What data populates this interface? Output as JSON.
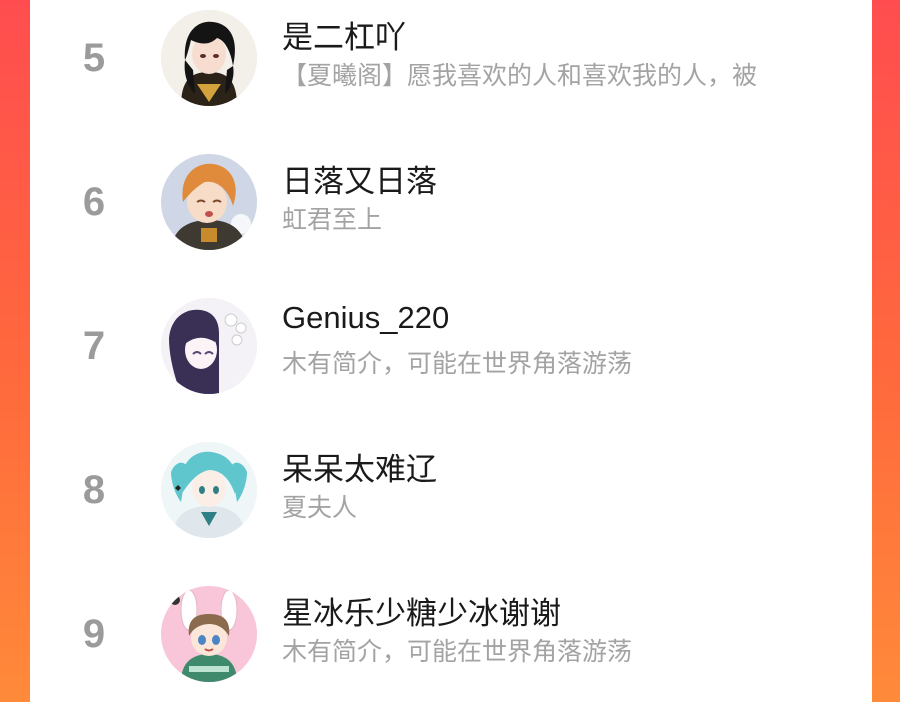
{
  "ranking": {
    "items": [
      {
        "rank": "5",
        "name": "是二杠吖",
        "bio": "【夏曦阁】愿我喜欢的人和喜欢我的人，被"
      },
      {
        "rank": "6",
        "name": "日落又日落",
        "bio": "虹君至上"
      },
      {
        "rank": "7",
        "name": "Genius_220",
        "bio": "木有简介，可能在世界角落游荡"
      },
      {
        "rank": "8",
        "name": "呆呆太难辽",
        "bio": "夏夫人"
      },
      {
        "rank": "9",
        "name": "星冰乐少糖少冰谢谢",
        "bio": "木有简介，可能在世界角落游荡"
      }
    ]
  },
  "colors": {
    "background_gradient_top": "#ff4d4f",
    "background_gradient_bottom": "#ff8a3a",
    "rank_number": "#9b9b9b",
    "name_text": "#1a1a1a",
    "bio_text": "#a3a3a3"
  },
  "icons": {
    "avatar_5": "avatar-anime-dark-hair",
    "avatar_6": "avatar-anime-orange-hair",
    "avatar_7": "avatar-anime-purple-hair",
    "avatar_8": "avatar-anime-teal-hair",
    "avatar_9": "avatar-anime-bunny-ears"
  }
}
